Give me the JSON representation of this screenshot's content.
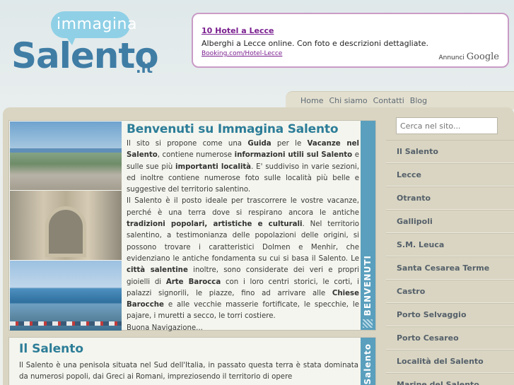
{
  "logo": {
    "small": "immagina",
    "big": "Salento",
    "suffix": ".it"
  },
  "ad": {
    "title": "10 Hotel a Lecce",
    "text": "Alberghi a Lecce online. Con foto e descrizioni dettagliate.",
    "url": "Booking.com/Hotel-Lecce",
    "attribution": "Annunci",
    "brand": "Google"
  },
  "topnav": [
    "Home",
    "Chi siamo",
    "Contatti",
    "Blog"
  ],
  "search": {
    "placeholder": "Cerca nel sito..."
  },
  "sidebar": {
    "items": [
      "Il Salento",
      "Lecce",
      "Otranto",
      "Gallipoli",
      "S.M. Leuca",
      "Santa Cesarea Terme",
      "Castro",
      "Porto Selvaggio",
      "Porto Cesareo",
      "Località del Salento",
      "Marine del Salento"
    ]
  },
  "article1": {
    "title": "Benvenuti su Immagina Salento",
    "tab_label": "BENVENUTI",
    "p1_a": "Il sito si propone come una ",
    "p1_b": "Guida",
    "p1_c": " per le ",
    "p1_d": "Vacanze nel Salento",
    "p1_e": ", contiene numerose ",
    "p1_f": "informazioni utili sul Salento",
    "p1_g": " e sulle sue più ",
    "p1_h": "importanti località",
    "p1_i": ". E' suddiviso in varie sezioni, ed inoltre contiene numerose foto sulle località più belle e suggestive del territorio salentino.",
    "p2_a": "Il Salento è il posto ideale per trascorrere le vostre vacanze, perché è una terra dove si respirano ancora le antiche ",
    "p2_b": "tradizioni popolari, artistiche e culturali",
    "p2_c": ". Nel territorio salentino, a testimonianza delle popolazioni delle origini, si possono trovare i caratteristici Dolmen e Menhir, che evidenziano le antiche fondamenta su cui si basa il Salento. Le ",
    "p2_d": "città salentine",
    "p2_e": " inoltre, sono considerate dei veri e propri gioielli di ",
    "p2_f": "Arte Barocca",
    "p2_g": " con i loro centri storici, le corti, i palazzi signorili, le piazze, fino ad arrivare alle ",
    "p2_h": "Chiese Barocche",
    "p2_i": " e alle vecchie masserie fortificate, le specchie, le pajare, i muretti a secco, le torri costiere.",
    "p3": "Buona Navigazione..."
  },
  "article2": {
    "title": "Il Salento",
    "tab_label": "Salento",
    "text": "Il Salento è una penisola situata nel Sud dell'Italia, in passato questa terra è stata dominata da numerosi popoli, dai Greci ai Romani, impreziosendo il territorio di opere"
  },
  "colors": {
    "accent": "#2c7d98",
    "tab": "#5a9fbd",
    "frame": "#d9d5c2",
    "ad_border": "#c99bc6"
  }
}
